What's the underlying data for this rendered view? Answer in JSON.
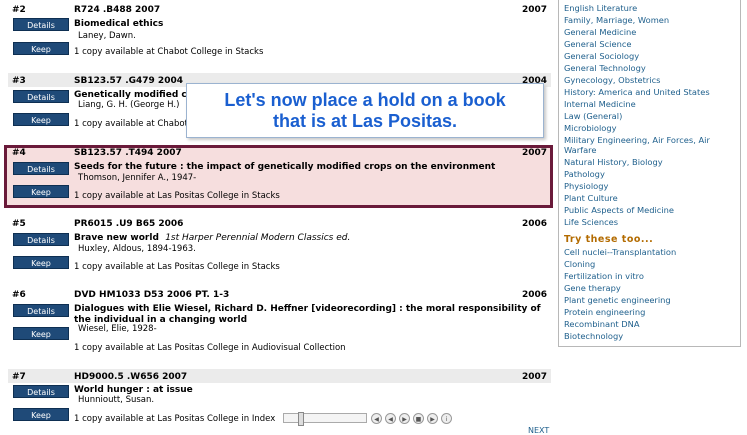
{
  "callout": {
    "line1": "Let's now place a hold on a book",
    "line2": "that is at Las Positas."
  },
  "records": [
    {
      "num": "#2",
      "call": "R724 .B488 2007",
      "year": "2007",
      "title": "Biomedical ethics",
      "title_extra": "",
      "author": "Laney, Dawn.",
      "copy": "1 copy available at Chabot College in Stacks",
      "details": "Details",
      "keep": "Keep"
    },
    {
      "num": "#3",
      "call": "SB123.57 .G479 2004",
      "year": "2004",
      "title": "Genetically modified c",
      "title_extra": "",
      "author": "Liang, G. H. (George H.)",
      "copy": "1 copy available at Chabot",
      "details": "Details",
      "keep": "Keep"
    },
    {
      "num": "#4",
      "call": "SB123.57 .T494 2007",
      "year": "2007",
      "title": "Seeds for the future : the impact of genetically modified crops on the environment",
      "title_extra": "",
      "author": "Thomson, Jennifer A., 1947-",
      "copy": "1 copy available at Las Positas College in Stacks",
      "details": "Details",
      "keep": "Keep"
    },
    {
      "num": "#5",
      "call": "PR6015 .U9 B65 2006",
      "year": "2006",
      "title": "Brave new world",
      "title_extra": "1st Harper Perennial Modern Classics ed.",
      "author": "Huxley, Aldous, 1894-1963.",
      "copy": "1 copy available at Las Positas College in Stacks",
      "details": "Details",
      "keep": "Keep"
    },
    {
      "num": "#6",
      "call": "DVD HM1033 D53 2006 PT. 1-3",
      "year": "2006",
      "title": "Dialogues with Elie Wiesel, Richard D. Heffner [videorecording] : the moral responsibility of the individual in a changing world",
      "title_extra": "",
      "author": "Wiesel, Elie, 1928-",
      "copy": "1 copy available at Las Positas College in Audiovisual Collection",
      "details": "Details",
      "keep": "Keep"
    },
    {
      "num": "#7",
      "call": "HD9000.5 .W656 2007",
      "year": "2007",
      "title": "World hunger : at issue",
      "title_extra": "",
      "author": "Hunnioutt, Susan.",
      "copy": "1 copy available at Las Positas College in Index",
      "details": "Details",
      "keep": "Keep"
    }
  ],
  "sidebar": {
    "subjects": [
      "English Literature",
      "Family, Marriage, Women",
      "General Medicine",
      "General Science",
      "General Sociology",
      "General Technology",
      "Gynecology, Obstetrics",
      "History: America and United States",
      "Internal Medicine",
      "Law (General)",
      "Microbiology",
      "Military Engineering, Air Forces, Air Warfare",
      "Natural History, Biology",
      "Pathology",
      "Physiology",
      "Plant Culture",
      "Public Aspects of Medicine",
      "Life Sciences"
    ],
    "try_heading": "Try these too...",
    "try_items": [
      "Cell nuclei--Transplantation",
      "Cloning",
      "Fertilization in vitro",
      "Gene therapy",
      "Plant genetic engineering",
      "Protein engineering",
      "Recombinant DNA",
      "Biotechnology"
    ]
  },
  "player": {
    "icons": [
      "skip-start-icon",
      "rewind-icon",
      "play-icon",
      "stop-icon",
      "fast-forward-icon",
      "info-icon"
    ]
  },
  "more_link": "NEXT"
}
